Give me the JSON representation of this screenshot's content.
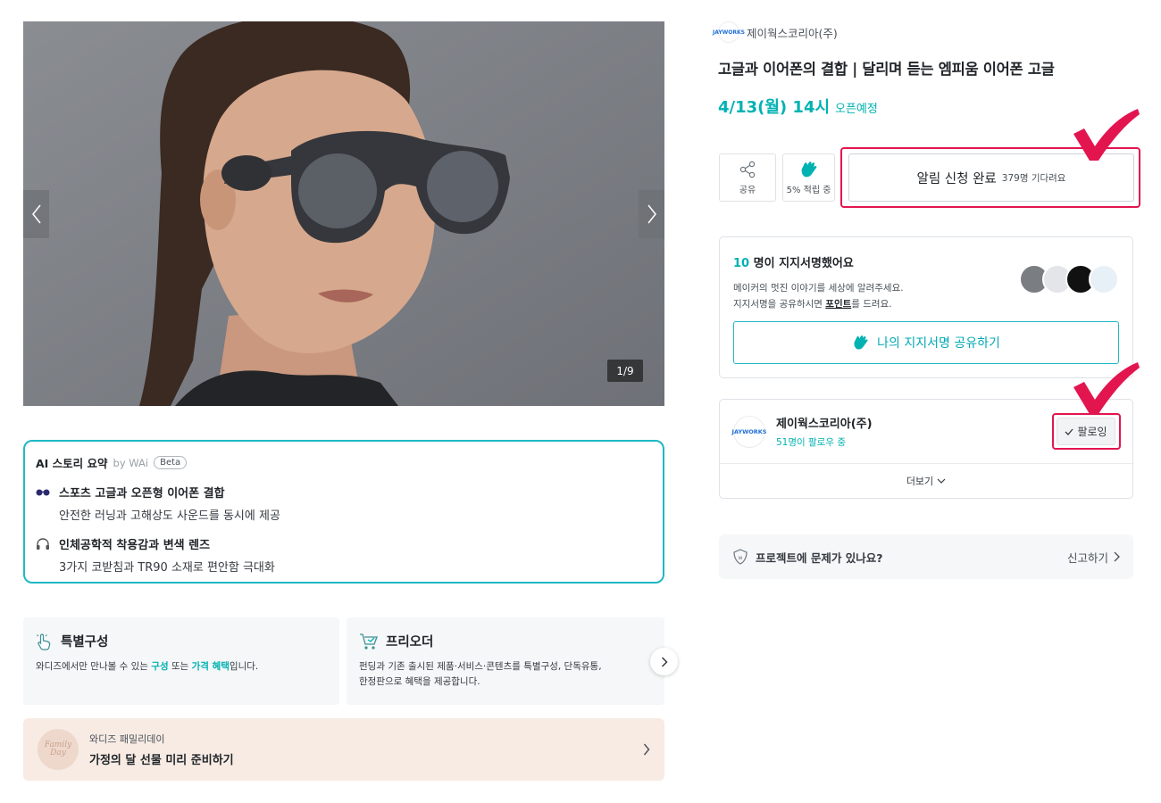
{
  "gallery": {
    "counter": "1/9"
  },
  "ai_summary": {
    "title": "AI 스토리 요약",
    "by": "by WAi",
    "badge": "Beta",
    "items": [
      {
        "icon": "sunglasses-icon",
        "title": "스포츠 고글과 오픈형 이어폰 결합",
        "desc": "안전한 러닝과 고해상도 사운드를 동시에 제공"
      },
      {
        "icon": "headphones-icon",
        "title": "인체공학적 착용감과 변색 렌즈",
        "desc": "3가지 코받침과 TR90 소재로 편안함 극대화"
      }
    ]
  },
  "features": [
    {
      "icon": "pointing-hand-icon",
      "title": "특별구성",
      "desc_pre": "와디즈에서만 만나볼 수 있는 ",
      "hl1": "구성",
      "desc_mid": " 또는 ",
      "hl2": "가격 혜택",
      "desc_post": "입니다."
    },
    {
      "icon": "shopping-cart-icon",
      "title": "프리오더",
      "desc_line1": "펀딩과 기존 출시된 제품·서비스·콘텐츠를 특별구성, 단독유통,",
      "desc_line2": "한정판으로 혜택을 제공합니다."
    }
  ],
  "promo": {
    "thumb_text": "Family Day",
    "small": "와디즈 패밀리데이",
    "big": "가정의 달 선물 미리 준비하기"
  },
  "maker": {
    "logo_text": "JAYWORKS",
    "name": "제이웍스코리아(주)",
    "followers": "51명이 팔로우 중",
    "follow_label": "팔로잉",
    "more_label": "더보기"
  },
  "product": {
    "title": "고글과 이어폰의 결합 | 달리며 듣는 엠피움 이어폰 고글",
    "open_date": "4/13(월) 14시",
    "open_status": "오픈예정"
  },
  "actions": {
    "share_label": "공유",
    "cheer_label": "5% 적립 중",
    "notify_main": "알림 신청 완료",
    "notify_sub": "379명 기다려요"
  },
  "support": {
    "count": "10",
    "title_rest": " 명이 지지서명했어요",
    "desc_line1": "메이커의 멋진 이야기를 세상에 알려주세요.",
    "desc_line2_pre": "지지서명을 공유하시면 ",
    "desc_line2_em": "포인트",
    "desc_line2_post": "를 드려요.",
    "share_button": "나의 지지서명 공유하기"
  },
  "report": {
    "question": "프로젝트에 문제가 있나요?",
    "link": "신고하기"
  },
  "colors": {
    "accent": "#00b2b2",
    "highlight_frame": "#e3154f",
    "ai_border": "#1fb8c4"
  }
}
